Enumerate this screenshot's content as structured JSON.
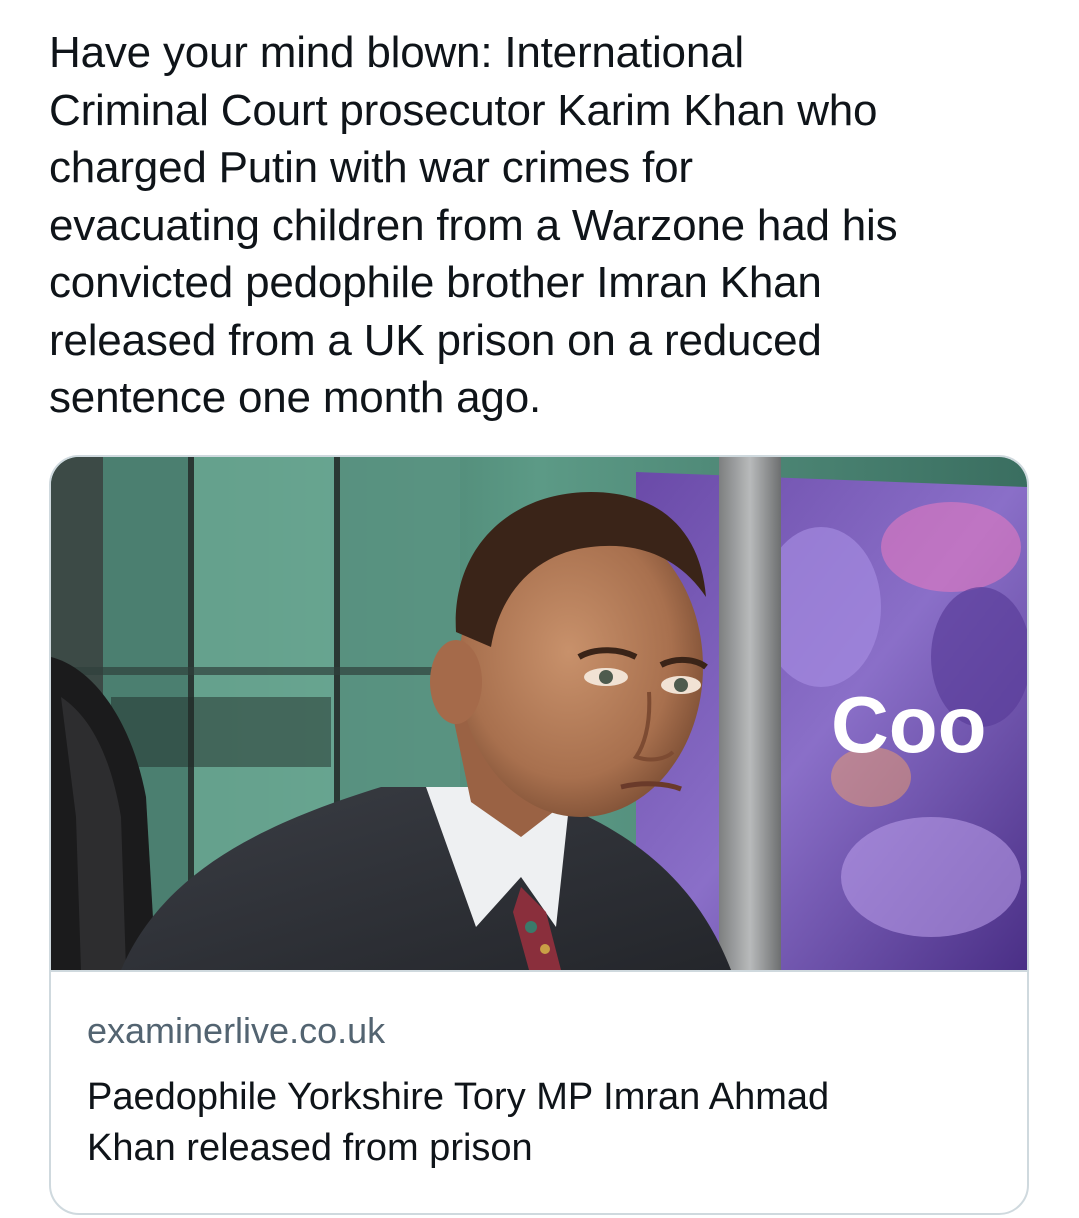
{
  "tweet": {
    "text": "Have your mind blown: International\nCriminal Court prosecutor Karim Khan who\ncharged Putin with war crimes for\nevacuating children from a Warzone had his\nconvicted pedophile brother Imran Khan\nreleased from a UK prison on a reduced\nsentence one month ago."
  },
  "card": {
    "domain": "examinerlive.co.uk",
    "title": "Paedophile Yorkshire Tory MP Imran Ahmad\nKhan released from prison",
    "image_sign_text": "Coo"
  },
  "colors": {
    "text": "#0f1419",
    "secondary_text": "#536471",
    "border": "#cfd9de"
  }
}
